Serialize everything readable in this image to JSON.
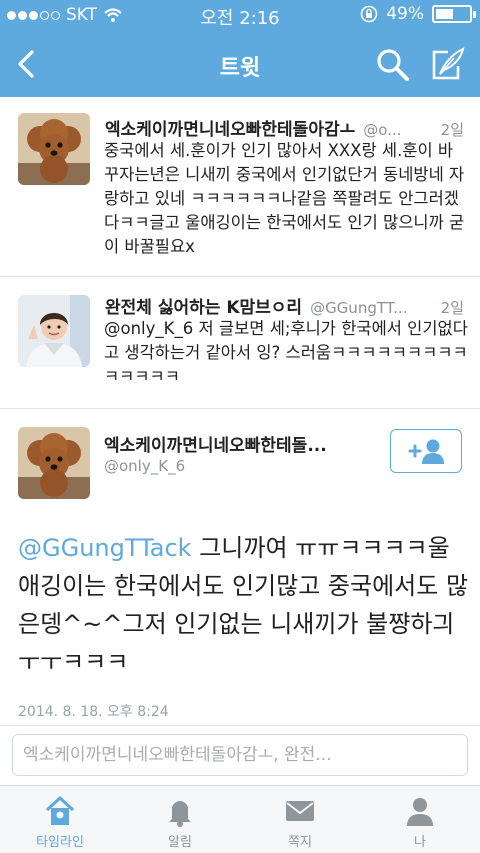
{
  "status_bar": {
    "carrier": "SKT",
    "time": "오전 2:16",
    "battery": "49%",
    "battery_level": 0.49
  },
  "nav": {
    "title": "트윗",
    "icons": [
      "back-icon",
      "search-icon",
      "compose-icon"
    ]
  },
  "tweets": [
    {
      "author": "엑소케이까면니네오빠한테돌아감ㅗ",
      "handle": "@o...",
      "age": "2일",
      "text": "중국에서 세.훈이가 인기 많아서 XXX랑 세.훈이 바꾸자는년은 니새끼 중국에서 인기없단거 동네방네 자랑하고 있네 ㅋㅋㅋㅋㅋㅋ나같음 쪽팔려도 안그러겠다ㅋㅋ글고 울애깅이는 한국에서도 인기 많으니까 굳이 바꿀필요x"
    },
    {
      "author": "완전체 싫어하는 K맘브ㅇ리",
      "handle": "@GGungTT...",
      "age": "2일",
      "mention": "@only_K_6",
      "text": " 저 글보면 세;후니가 한국에서 인기없다고 생각하는거 같아서 잉? 스러움ㅋㅋㅋㅋㅋㅋㅋㅋㅋㅋㅋㅋㅋㅋ"
    }
  ],
  "detail": {
    "author": "엑소케이까면니네오빠한테돌...",
    "handle": "@only_K_6",
    "mention": "@GGungTTack",
    "text": " 그니까여 ㅠㅠㅋㅋㅋㅋ울애깅이는 한국에서도 인기많고 중국에서도 많은뎅^~^그저 인기없는 니새끼가 불쨩하긔 ㅜㅜㅋㅋㅋ",
    "timestamp": "2014. 8. 18. 오후 8:24",
    "follow_icon": "add-user-icon"
  },
  "reply": {
    "placeholder": "엑소케이까면니네오빠한테돌아감ㅗ, 완전..."
  },
  "tabs": [
    {
      "label": "타임라인",
      "icon": "home-icon",
      "active": true
    },
    {
      "label": "알림",
      "icon": "bell-icon",
      "active": false
    },
    {
      "label": "쪽지",
      "icon": "envelope-icon",
      "active": false
    },
    {
      "label": "나",
      "icon": "person-icon",
      "active": false
    }
  ],
  "colors": {
    "brand": "#5ea9dd",
    "tab_inactive": "#8e969c",
    "secondary_text": "#8a939a"
  }
}
